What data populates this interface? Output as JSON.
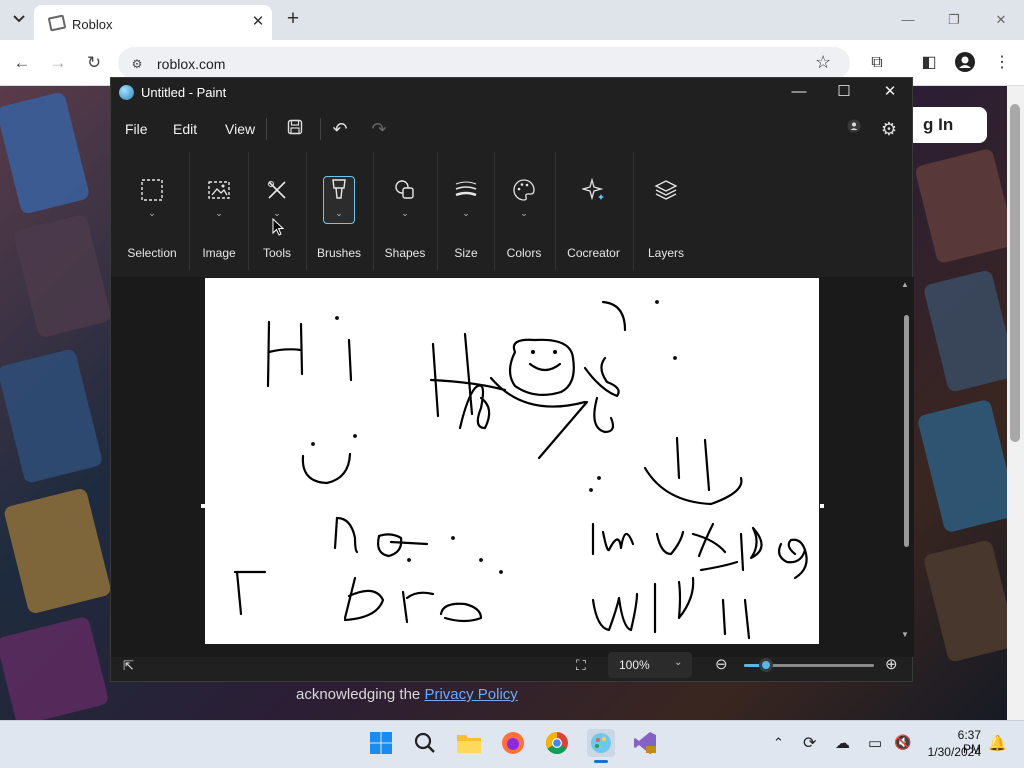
{
  "browser": {
    "tab_title": "Roblox",
    "url": "roblox.com"
  },
  "roblox": {
    "login_label": "g In",
    "privacy_prefix": "acknowledging the ",
    "privacy_link": "Privacy Policy"
  },
  "paint": {
    "title": "Untitled - Paint",
    "menus": [
      "File",
      "Edit",
      "View"
    ],
    "ribbon_groups": [
      {
        "label": "Selection",
        "icon": "selection-icon"
      },
      {
        "label": "Image",
        "icon": "image-icon"
      },
      {
        "label": "Tools",
        "icon": "tools-icon"
      },
      {
        "label": "Brushes",
        "icon": "brush-icon"
      },
      {
        "label": "Shapes",
        "icon": "shapes-icon"
      },
      {
        "label": "Size",
        "icon": "size-icon"
      },
      {
        "label": "Colors",
        "icon": "palette-icon"
      },
      {
        "label": "Cocreator",
        "icon": "sparkle-icon"
      },
      {
        "label": "Layers",
        "icon": "layers-icon"
      }
    ],
    "active_group": "Brushes",
    "zoom": "100%",
    "zoom_slider_fraction": 0.17,
    "accent_color": "#5ab8e8"
  },
  "taskbar": {
    "apps": [
      "windows-start-icon",
      "search-icon",
      "file-explorer-icon",
      "firefox-icon",
      "chrome-icon",
      "paint-icon",
      "visual-studio-icon"
    ],
    "time": "6:37 PM",
    "date": "1/30/2024"
  }
}
